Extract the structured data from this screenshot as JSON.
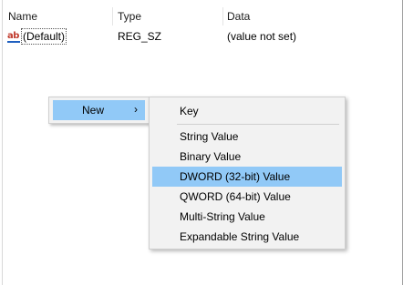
{
  "list": {
    "columns": {
      "name": "Name",
      "type": "Type",
      "data": "Data"
    },
    "rows": [
      {
        "icon": "string-value-icon",
        "icon_glyph": "ab",
        "name": "(Default)",
        "type": "REG_SZ",
        "data": "(value not set)"
      }
    ]
  },
  "context_menu": {
    "item": "New",
    "chevron": "›"
  },
  "submenu": {
    "items": [
      {
        "label": "Key"
      },
      {
        "label": "String Value"
      },
      {
        "label": "Binary Value"
      },
      {
        "label": "DWORD (32-bit) Value",
        "highlighted": true
      },
      {
        "label": "QWORD (64-bit) Value"
      },
      {
        "label": "Multi-String Value"
      },
      {
        "label": "Expandable String Value"
      }
    ]
  },
  "colors": {
    "highlight": "#91c9f7",
    "menu_background": "#f2f2f2",
    "icon_red": "#c0392b"
  }
}
